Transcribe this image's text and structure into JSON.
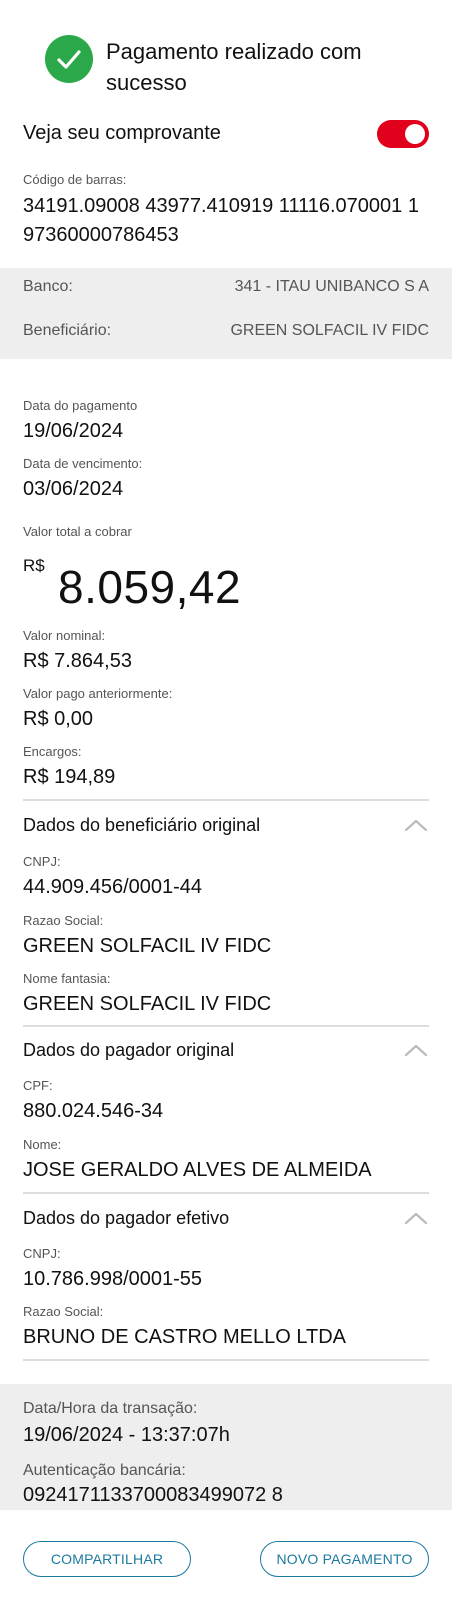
{
  "header": {
    "title": "Pagamento realizado com sucesso",
    "success_icon": "check-circle-icon"
  },
  "receipt": {
    "label": "Veja seu comprovante",
    "toggle_on": true
  },
  "barcode": {
    "label": "Código de barras:",
    "value": "34191.09008 43977.410919 11116.070001 1 97360000786453"
  },
  "bank_info": {
    "bank_label": "Banco:",
    "bank_value": "341 - ITAU UNIBANCO S A",
    "beneficiary_label": "Beneficiário:",
    "beneficiary_value": "GREEN SOLFACIL IV FIDC"
  },
  "payment": {
    "payment_date_label": "Data do pagamento",
    "payment_date": "19/06/2024",
    "due_date_label": "Data de vencimento:",
    "due_date": "03/06/2024",
    "total_label": "Valor total a cobrar",
    "currency": "R$",
    "total_value": "8.059,42",
    "nominal_label": "Valor nominal:",
    "nominal_value": "R$ 7.864,53",
    "paid_before_label": "Valor pago anteriormente:",
    "paid_before_value": "R$ 0,00",
    "charges_label": "Encargos:",
    "charges_value": "R$ 194,89"
  },
  "original_beneficiary": {
    "title": "Dados do beneficiário original",
    "cnpj_label": "CNPJ:",
    "cnpj": "44.909.456/0001-44",
    "corporate_name_label": "Razao Social:",
    "corporate_name": "GREEN SOLFACIL IV FIDC",
    "trade_name_label": "Nome fantasia:",
    "trade_name": "GREEN SOLFACIL IV FIDC"
  },
  "original_payer": {
    "title": "Dados do pagador original",
    "cpf_label": "CPF:",
    "cpf": "880.024.546-34",
    "name_label": "Nome:",
    "name": "JOSE GERALDO ALVES DE ALMEIDA"
  },
  "effective_payer": {
    "title": "Dados do pagador efetivo",
    "cnpj_label": "CNPJ:",
    "cnpj": "10.786.998/0001-55",
    "corporate_name_label": "Razao Social:",
    "corporate_name": "BRUNO DE CASTRO MELLO LTDA"
  },
  "transaction": {
    "datetime_label": "Data/Hora da transação:",
    "datetime": "19/06/2024 - 13:37:07h",
    "auth_label": "Autenticação bancária:",
    "auth": "0924171133700083499072 8"
  },
  "actions": {
    "share_label": "COMPARTILHAR",
    "new_payment_label": "NOVO PAGAMENTO"
  },
  "colors": {
    "success_green": "#2aa84a",
    "toggle_red": "#e0001b",
    "button_blue": "#1b7aa0",
    "panel_gray": "#eeeeee"
  }
}
